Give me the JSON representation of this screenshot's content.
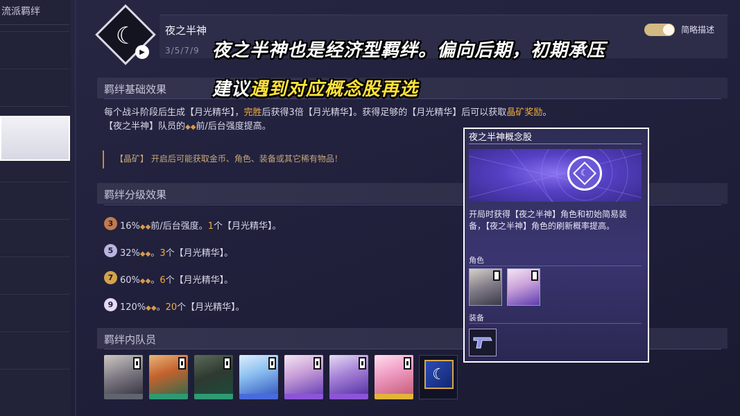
{
  "sidebar": {
    "header": "流派羁绊"
  },
  "header": {
    "bond_name": "夜之半神",
    "tiers": "3/5/7/9",
    "toggle_label": "简略描述",
    "toggle_on": true
  },
  "overlay": {
    "line1": "夜之半神也是经济型羁绊。偏向后期，初期承压",
    "line2_prefix": "建议",
    "line2_highlight": "遇到对应概念股再选"
  },
  "base_effect": {
    "title": "羁绊基础效果",
    "line1_a": "每个战斗阶段后生成【月光精华】，",
    "line1_gold1": "完胜",
    "line1_b": "后获得3倍【月光精华】。获得足够的【月光精华】后可以获取",
    "line1_gold2": "晶矿奖励",
    "line1_c": "。",
    "line2_a": "【夜之半神】队员的",
    "line2_b": "前/后台强度提高。",
    "note": "【晶矿】 开启后可能获取金币、角色、装备或其它稀有物品！"
  },
  "tier_effect": {
    "title": "羁绊分级效果",
    "rows": [
      {
        "badge": "3",
        "pct": "16%",
        "mid": "前/后台强度。",
        "count": "1",
        "tail": "个【月光精华】。"
      },
      {
        "badge": "5",
        "pct": "32%",
        "mid": "。",
        "count": "3",
        "tail": "个【月光精华】。"
      },
      {
        "badge": "7",
        "pct": "60%",
        "mid": "。",
        "count": "6",
        "tail": "个【月光精华】。"
      },
      {
        "badge": "9",
        "pct": "120%",
        "mid": "。",
        "count": "20",
        "tail": "个【月光精华】。"
      }
    ]
  },
  "members": {
    "title": "羁绊内队员",
    "list": [
      {
        "name": "member-1",
        "band": "#5f6470"
      },
      {
        "name": "member-2",
        "band": "#2f9a73"
      },
      {
        "name": "member-3",
        "band": "#2f9a73"
      },
      {
        "name": "member-4",
        "band": "#4a6bdc"
      },
      {
        "name": "member-5",
        "band": "#8c55d8"
      },
      {
        "name": "member-6",
        "band": "#8c55d8"
      },
      {
        "name": "member-7",
        "band": "#e0b53a"
      }
    ]
  },
  "popup": {
    "title": "夜之半神概念股",
    "description": "开局时获得【夜之半神】角色和初始简易装备，【夜之半神】角色的刷新概率提高。",
    "characters_label": "角色",
    "equipment_label": "装备"
  },
  "colors": {
    "gold": "#f4ac3e",
    "highlight": "#ffe23a"
  }
}
